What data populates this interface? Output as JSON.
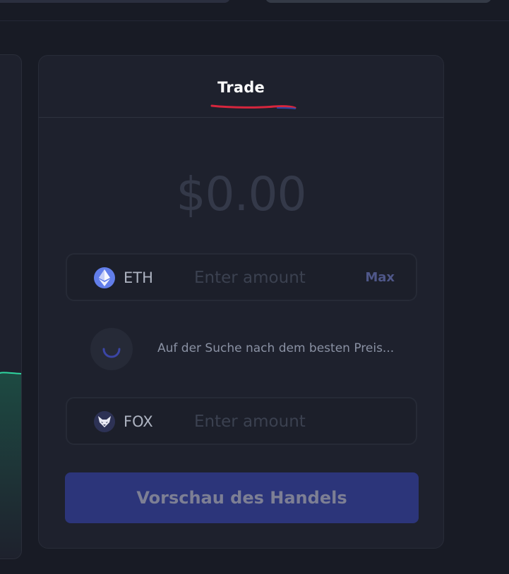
{
  "header": {
    "tab_label": "Trade"
  },
  "fiat": {
    "value": "$0.00"
  },
  "sell_asset": {
    "symbol": "ETH",
    "icon": "ethereum-icon",
    "amount": "",
    "placeholder": "Enter amount",
    "max_label": "Max"
  },
  "status": {
    "message": "Auf der Suche nach dem besten Preis..."
  },
  "buy_asset": {
    "symbol": "FOX",
    "icon": "fox-icon",
    "amount": "",
    "placeholder": "Enter amount"
  },
  "preview_button": {
    "label": "Vorschau des Handels"
  },
  "colors": {
    "background": "#181b25",
    "card": "#1e212d",
    "accent": "#2c357a",
    "eth": "#627eea",
    "chart_line": "#2fd6a0",
    "tab_underline": "#d7263d"
  }
}
